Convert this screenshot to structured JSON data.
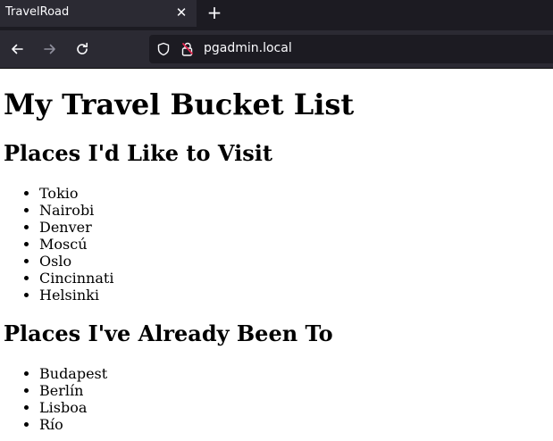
{
  "browser": {
    "tab": {
      "title": "TravelRoad",
      "close_icon": "close-icon"
    },
    "new_tab_icon": "plus-icon",
    "nav": {
      "back_icon": "arrow-left-icon",
      "forward_icon": "arrow-right-icon",
      "reload_icon": "reload-icon"
    },
    "urlbar": {
      "url": "pgadmin.local",
      "shield_icon": "shield-icon",
      "lock_icon": "lock-warning-icon"
    }
  },
  "page": {
    "title": "My Travel Bucket List",
    "sections": [
      {
        "heading": "Places I'd Like to Visit",
        "items": [
          "Tokio",
          "Nairobi",
          "Denver",
          "Moscú",
          "Oslo",
          "Cincinnati",
          "Helsinki"
        ]
      },
      {
        "heading": "Places I've Already Been To",
        "items": [
          "Budapest",
          "Berlín",
          "Lisboa",
          "Río"
        ]
      }
    ]
  },
  "colors": {
    "tabstrip_bg": "#1c1b22",
    "toolbar_bg": "#2b2a33",
    "urlbar_bg": "#1c1b22",
    "chrome_text": "#fbfbfe",
    "page_bg": "#ffffff",
    "page_text": "#000000"
  }
}
